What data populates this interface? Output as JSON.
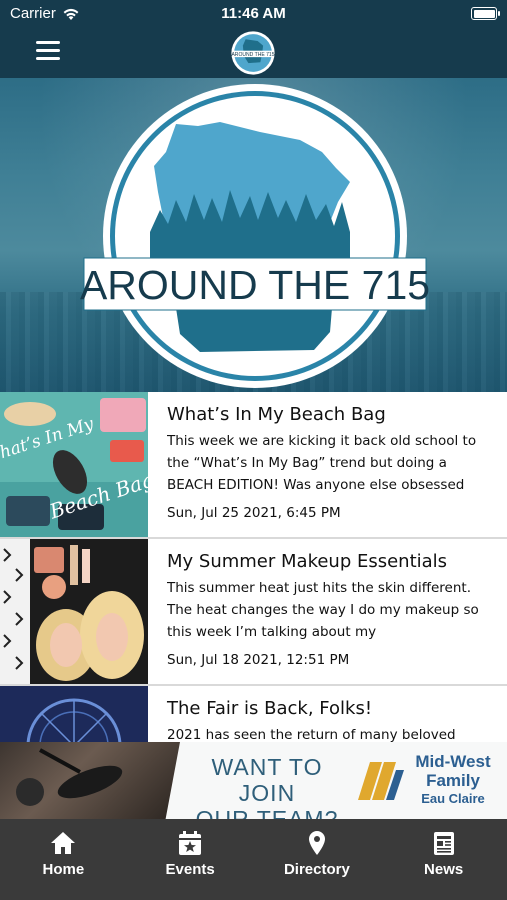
{
  "status_bar": {
    "carrier": "Carrier",
    "time": "11:46 AM",
    "battery_level": 1.0
  },
  "nav": {
    "icons": [
      "menu-icon"
    ]
  },
  "logo": {
    "text": "AROUND THE 715",
    "colors": {
      "brand": "#1f6f8b",
      "dark": "#163b4d",
      "light": "#4fa6cc"
    }
  },
  "posts": [
    {
      "title": "What’s In My Beach Bag",
      "excerpt": "This week we are kicking it back old school to the “What’s In My Bag” trend but doing a BEACH EDITION! Was anyone else obsessed",
      "date": "Sun, Jul 25 2021, 6:45 PM",
      "thumb_text_1": "What’s In My",
      "thumb_text_2": "Beach Bag"
    },
    {
      "title": "My Summer Makeup Essentials",
      "excerpt": "This summer heat just hits the skin different. The heat changes the way I do my makeup so this week I’m talking about my",
      "date": "Sun, Jul 18 2021, 12:51 PM"
    },
    {
      "title": "The Fair is Back, Folks!",
      "excerpt": "2021 has seen the return of many beloved",
      "date": ""
    }
  ],
  "banner": {
    "cta_line1": "WANT TO JOIN",
    "cta_line2": "OUR TEAM?",
    "brand_line1": "Mid-West",
    "brand_line2": "Family",
    "brand_line3": "Eau Claire"
  },
  "tabs": [
    {
      "label": "Home",
      "icon": "home-icon"
    },
    {
      "label": "Events",
      "icon": "calendar-star-icon"
    },
    {
      "label": "Directory",
      "icon": "map-pin-icon"
    },
    {
      "label": "News",
      "icon": "newspaper-icon"
    }
  ],
  "colors": {
    "nav_bg": "#163b4d",
    "tab_bg": "#3a3a3a",
    "divider": "#d9d9d9"
  }
}
